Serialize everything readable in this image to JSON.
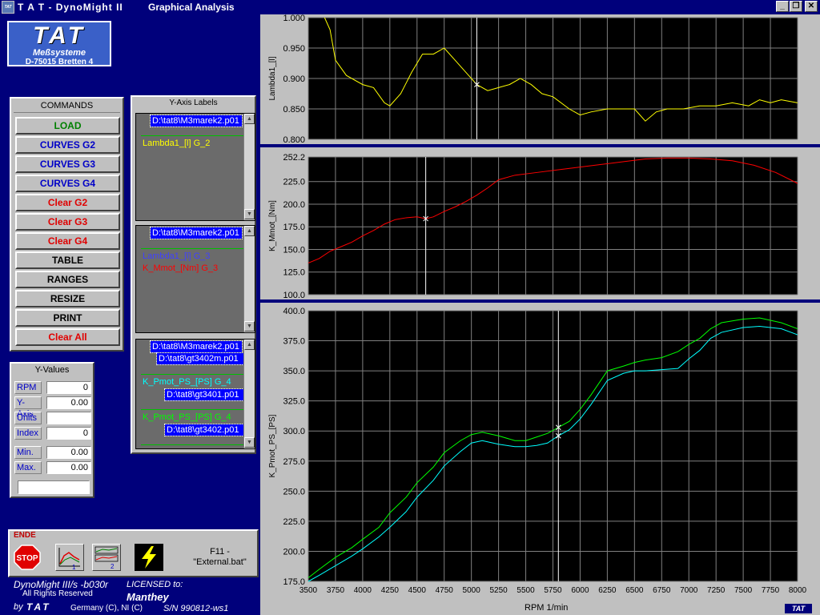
{
  "window": {
    "app_title": "T A T - DynoMight II",
    "doc_title": "Graphical Analysis",
    "icon_text": "TAT",
    "buttons": {
      "minimize": "_",
      "restore": "❐",
      "close": "✕"
    }
  },
  "logo": {
    "brand": "TAT",
    "line1": "Meßsysteme",
    "line2": "D-75015 Bretten 4"
  },
  "commands": {
    "title": "COMMANDS",
    "items": [
      {
        "label": "LOAD",
        "color": "#008000"
      },
      {
        "label": "CURVES G2",
        "color": "#0000c8"
      },
      {
        "label": "CURVES G3",
        "color": "#0000c8"
      },
      {
        "label": "CURVES G4",
        "color": "#0000c8"
      },
      {
        "label": "Clear G2",
        "color": "#e00000"
      },
      {
        "label": "Clear G3",
        "color": "#e00000"
      },
      {
        "label": "Clear G4",
        "color": "#e00000"
      },
      {
        "label": "TABLE",
        "color": "#000000"
      },
      {
        "label": "RANGES",
        "color": "#000000"
      },
      {
        "label": "RESIZE",
        "color": "#000000"
      },
      {
        "label": "PRINT",
        "color": "#000000"
      },
      {
        "label": "Clear All",
        "color": "#e00000"
      }
    ]
  },
  "y_values": {
    "title": "Y-Values",
    "rows": [
      {
        "label": "RPM",
        "value": "0"
      },
      {
        "label": "Y-Axis",
        "value": "0.00"
      },
      {
        "label": "Units",
        "value": ""
      },
      {
        "label": "Index",
        "value": "0"
      },
      {
        "label": "Min.",
        "value": "0.00"
      },
      {
        "label": "Max.",
        "value": "0.00"
      }
    ]
  },
  "y_axis_labels": {
    "title": "Y-Axis Labels",
    "g2": {
      "file": "D:\\tat8\\M3marek2.p01",
      "curves": [
        {
          "text": "Lambda1_[l] G_2",
          "color": "#ffff00"
        }
      ]
    },
    "g3": {
      "file": "D:\\tat8\\M3marek2.p01",
      "curves": [
        {
          "text": "Lambda1_[l] G_3",
          "color": "#4040ff"
        },
        {
          "text": "K_Mmot_[Nm] G_3",
          "color": "#ff0000"
        }
      ]
    },
    "g4": {
      "file1": "D:\\tat8\\M3marek2.p01",
      "file2": "D:\\tat8\\gt3402m.p01",
      "curve1": {
        "text": "K_Pmot_PS_[PS] G_4",
        "color": "#00ffff"
      },
      "file3": "D:\\tat8\\gt3401.p01",
      "curve2": {
        "text": "K_Pmot_PS_[PS] G_4",
        "color": "#00ff00"
      },
      "file4": "D:\\tat8\\gt3402.p01"
    }
  },
  "toolbar": {
    "ende": "ENDE",
    "stop": "STOP",
    "f11_line1": "F11 -",
    "f11_line2": "\"External.bat\""
  },
  "footer": {
    "version": "DynoMight III/s -b030r",
    "rights": "All Rights Reserved",
    "by": "by",
    "brand": "TAT",
    "country": "Germany (C), NI (C)",
    "licensed_label": "LICENSED to:",
    "licensee": "Manthey",
    "serial": "S/N  990812-ws1"
  },
  "x_axis": {
    "label": "RPM 1/min",
    "brand": "TAT"
  },
  "chart_data": [
    {
      "type": "line",
      "ylabel": "Lambda1_[l]",
      "ylim": [
        0.8,
        1.0
      ],
      "yticks": [
        "0.800",
        "0.850",
        "0.900",
        "0.950",
        "1.000"
      ],
      "xlim": [
        3500,
        8000
      ],
      "cursor_x": 5050,
      "grid": true,
      "series": [
        {
          "color": "#ffff00",
          "x": [
            3650,
            3700,
            3750,
            3850,
            4000,
            4100,
            4200,
            4250,
            4350,
            4450,
            4550,
            4650,
            4750,
            4850,
            4950,
            5050,
            5150,
            5250,
            5350,
            5450,
            5550,
            5650,
            5750,
            5900,
            6000,
            6100,
            6250,
            6400,
            6500,
            6600,
            6700,
            6800,
            6950,
            7100,
            7250,
            7400,
            7550,
            7650,
            7750,
            7850,
            8000
          ],
          "y": [
            1.0,
            0.98,
            0.93,
            0.905,
            0.89,
            0.885,
            0.86,
            0.855,
            0.875,
            0.91,
            0.94,
            0.94,
            0.95,
            0.93,
            0.91,
            0.89,
            0.88,
            0.885,
            0.89,
            0.9,
            0.89,
            0.875,
            0.87,
            0.85,
            0.84,
            0.845,
            0.85,
            0.85,
            0.85,
            0.83,
            0.845,
            0.85,
            0.85,
            0.855,
            0.855,
            0.86,
            0.855,
            0.865,
            0.86,
            0.865,
            0.86
          ]
        }
      ]
    },
    {
      "type": "line",
      "ylabel": "K_Mmot_[Nm]",
      "ylim": [
        100,
        252.2
      ],
      "yticks": [
        "100.0",
        "125.0",
        "150.0",
        "175.0",
        "200.0",
        "225.0",
        "252.2"
      ],
      "xlim": [
        3500,
        8000
      ],
      "cursor_x": 4580,
      "grid": true,
      "series": [
        {
          "color": "#ff0000",
          "x": [
            3500,
            3600,
            3700,
            3800,
            3900,
            4000,
            4100,
            4200,
            4300,
            4400,
            4500,
            4580,
            4650,
            4750,
            4850,
            4950,
            5050,
            5150,
            5250,
            5400,
            5600,
            5800,
            6000,
            6200,
            6400,
            6600,
            6800,
            7000,
            7200,
            7400,
            7600,
            7800,
            8000
          ],
          "y": [
            135,
            140,
            148,
            153,
            158,
            165,
            171,
            178,
            183,
            185,
            186,
            184,
            186,
            192,
            197,
            203,
            210,
            218,
            227,
            232,
            235,
            238,
            241,
            244,
            247,
            250,
            251,
            251,
            250,
            248,
            243,
            235,
            223
          ]
        }
      ]
    },
    {
      "type": "line",
      "ylabel": "K_Pmot_PS_[PS]",
      "xlabel": "RPM 1/min",
      "ylim": [
        175,
        400
      ],
      "yticks": [
        "175.0",
        "200.0",
        "225.0",
        "250.0",
        "275.0",
        "300.0",
        "325.0",
        "350.0",
        "375.0",
        "400.0"
      ],
      "xlim": [
        3500,
        8000
      ],
      "xticks": [
        3500,
        3750,
        4000,
        4250,
        4500,
        4750,
        5000,
        5250,
        5500,
        5750,
        6000,
        6250,
        6500,
        6750,
        7000,
        7250,
        7500,
        7750,
        8000
      ],
      "cursor_x": 5800,
      "grid": true,
      "series": [
        {
          "color": "#00ff00",
          "x": [
            3500,
            3600,
            3750,
            3900,
            4000,
            4150,
            4250,
            4400,
            4500,
            4650,
            4750,
            4900,
            5000,
            5100,
            5250,
            5400,
            5500,
            5600,
            5700,
            5800,
            5900,
            6000,
            6100,
            6250,
            6400,
            6500,
            6600,
            6750,
            6900,
            7000,
            7100,
            7200,
            7300,
            7500,
            7650,
            7750,
            7850,
            8000
          ],
          "y": [
            178,
            185,
            195,
            203,
            210,
            220,
            232,
            245,
            257,
            270,
            282,
            292,
            297,
            299,
            296,
            292,
            292,
            295,
            298,
            303,
            308,
            318,
            330,
            350,
            354,
            357,
            359,
            361,
            366,
            372,
            377,
            385,
            390,
            393,
            394,
            392,
            390,
            385
          ]
        },
        {
          "color": "#00ffff",
          "x": [
            3500,
            3600,
            3750,
            3900,
            4000,
            4150,
            4250,
            4400,
            4500,
            4650,
            4750,
            4900,
            5000,
            5100,
            5250,
            5400,
            5500,
            5600,
            5700,
            5800,
            5900,
            6000,
            6100,
            6250,
            6400,
            6500,
            6600,
            6750,
            6900,
            7000,
            7100,
            7200,
            7300,
            7500,
            7650,
            7750,
            7850,
            8000
          ],
          "y": [
            175,
            180,
            188,
            196,
            202,
            212,
            220,
            233,
            245,
            259,
            271,
            283,
            290,
            292,
            289,
            287,
            287,
            288,
            290,
            296,
            301,
            310,
            322,
            342,
            348,
            350,
            350,
            351,
            352,
            360,
            367,
            377,
            382,
            386,
            387,
            386,
            385,
            380
          ]
        }
      ]
    }
  ]
}
